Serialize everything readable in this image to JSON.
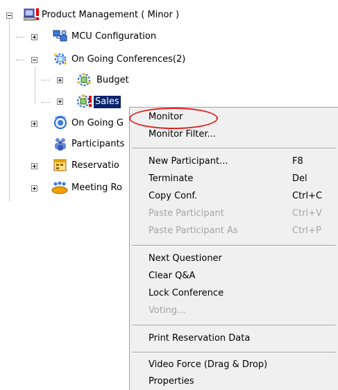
{
  "tree": {
    "root": "Product Management   ( Minor )",
    "items": [
      {
        "label": "MCU Configuration"
      },
      {
        "label": "On Going Conferences(2)"
      },
      {
        "label": "Budget"
      },
      {
        "label": "Sales"
      },
      {
        "label": "On Going G"
      },
      {
        "label": "Participants"
      },
      {
        "label": "Reservatio"
      },
      {
        "label": "Meeting Ro"
      }
    ]
  },
  "menu": {
    "items": [
      {
        "label": "Monitor",
        "shortcut": "",
        "enabled": true
      },
      {
        "label": "Monitor Filter...",
        "shortcut": "",
        "enabled": true
      },
      {
        "label": "New Participant...",
        "shortcut": "F8",
        "enabled": true
      },
      {
        "label": "Terminate",
        "shortcut": "Del",
        "enabled": true
      },
      {
        "label": "Copy Conf.",
        "shortcut": "Ctrl+C",
        "enabled": true
      },
      {
        "label": "Paste Participant",
        "shortcut": "Ctrl+V",
        "enabled": false
      },
      {
        "label": "Paste Participant As",
        "shortcut": "Ctrl+P",
        "enabled": false
      },
      {
        "label": "Next Questioner",
        "shortcut": "",
        "enabled": true
      },
      {
        "label": "Clear Q&A",
        "shortcut": "",
        "enabled": true
      },
      {
        "label": "Lock Conference",
        "shortcut": "",
        "enabled": true
      },
      {
        "label": "Voting...",
        "shortcut": "",
        "enabled": false
      },
      {
        "label": "Print Reservation Data",
        "shortcut": "",
        "enabled": true
      },
      {
        "label": "Video Force (Drag & Drop)",
        "shortcut": "",
        "enabled": true
      },
      {
        "label": "Properties",
        "shortcut": "",
        "enabled": true
      }
    ]
  },
  "colors": {
    "selection": "#0a246a",
    "highlight_circle": "#e02020",
    "disabled_text": "#a5a5a5"
  },
  "icons": {
    "root": "server-warning-icon",
    "mcu": "network-config-icon",
    "conferences": "conference-group-icon",
    "budget": "conference-icon",
    "sales": "conference-alert-icon",
    "ongoing_g": "ongoing-gateway-icon",
    "participants": "participants-icon",
    "reservations": "reservation-calendar-icon",
    "meeting_rooms": "meeting-room-icon"
  }
}
